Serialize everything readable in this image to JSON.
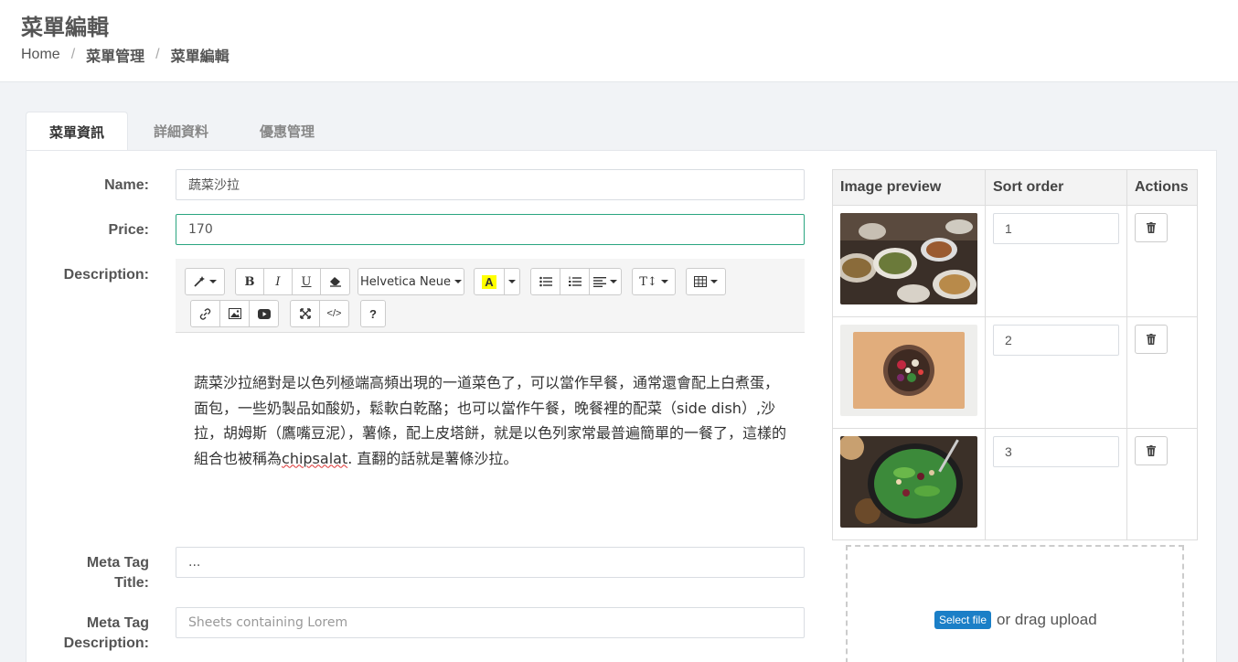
{
  "page": {
    "title": "菜單編輯"
  },
  "breadcrumb": [
    {
      "label": "Home"
    },
    {
      "label": "菜單管理"
    },
    {
      "label": "菜單編輯"
    }
  ],
  "tabs": [
    {
      "label": "菜單資訊",
      "active": true
    },
    {
      "label": "詳細資料",
      "active": false
    },
    {
      "label": "優惠管理",
      "active": false
    }
  ],
  "form": {
    "name_label": "Name:",
    "name_value": "蔬菜沙拉",
    "price_label": "Price:",
    "price_value": "170",
    "description_label": "Description:",
    "meta_title_label_1": "Meta Tag",
    "meta_title_label_2": "Title:",
    "meta_title_value": "...",
    "meta_desc_label_1": "Meta Tag",
    "meta_desc_label_2": "Description:",
    "meta_desc_placeholder": "Sheets containing Lorem"
  },
  "editor": {
    "font_name": "Helvetica Neue",
    "highlight_color": "#ffff00",
    "help_label": "?",
    "content_part1": "蔬菜沙拉絕對是以色列極端高頻出現的一道菜色了，可以當作早餐，通常還會配上白煮蛋，面包，一些奶製品如酸奶，鬆軟白乾酪；也可以當作午餐，晚餐裡的配菜（side dish）,沙拉，胡姆斯（鷹嘴豆泥），薯條，配上皮塔餅，就是以色列家常最普遍簡單的一餐了，這樣的組合也被稱為",
    "content_word": "chipsalat",
    "content_part2": ". 直翻的話就是薯條沙拉。"
  },
  "images_table": {
    "headers": [
      "Image preview",
      "Sort order",
      "Actions"
    ],
    "rows": [
      {
        "sort": "1",
        "preview": "food-buffet-image"
      },
      {
        "sort": "2",
        "preview": "salad-bowl-on-board-image"
      },
      {
        "sort": "3",
        "preview": "green-salad-image"
      }
    ]
  },
  "upload": {
    "select_label": "Select file",
    "drag_label": "or drag upload"
  },
  "colors": {
    "accent": "#2aa580",
    "button_blue": "#1b7fc7"
  }
}
